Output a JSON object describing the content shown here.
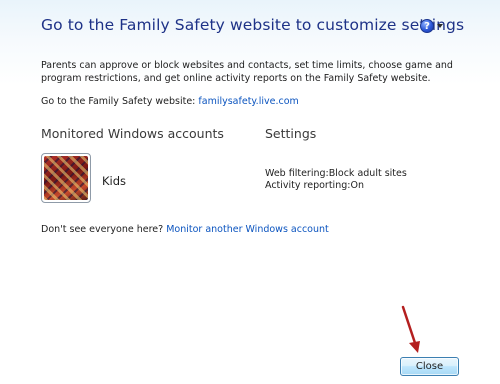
{
  "header": {
    "title": "Go to the Family Safety website to customize settings",
    "help_icon": "help-question-icon"
  },
  "description": "Parents can approve or block websites and contacts, set time limits, choose game and program restrictions, and get online activity reports on the Family Safety website.",
  "website": {
    "label": "Go to the Family Safety website:",
    "link": "familysafety.live.com"
  },
  "columns": {
    "accounts": "Monitored Windows accounts",
    "settings": "Settings"
  },
  "account": {
    "name": "Kids",
    "web_filtering_label": "Web filtering:",
    "web_filtering_value": "Block adult sites",
    "activity_reporting_label": "Activity reporting:",
    "activity_reporting_value": "On"
  },
  "footer": {
    "dont_see_text": "Don't see everyone here?",
    "monitor_link": "Monitor another Windows account"
  },
  "buttons": {
    "close": "Close"
  },
  "colors": {
    "heading": "#1e3287",
    "link": "#0b54bf",
    "annotation_arrow": "#b41f1f"
  }
}
